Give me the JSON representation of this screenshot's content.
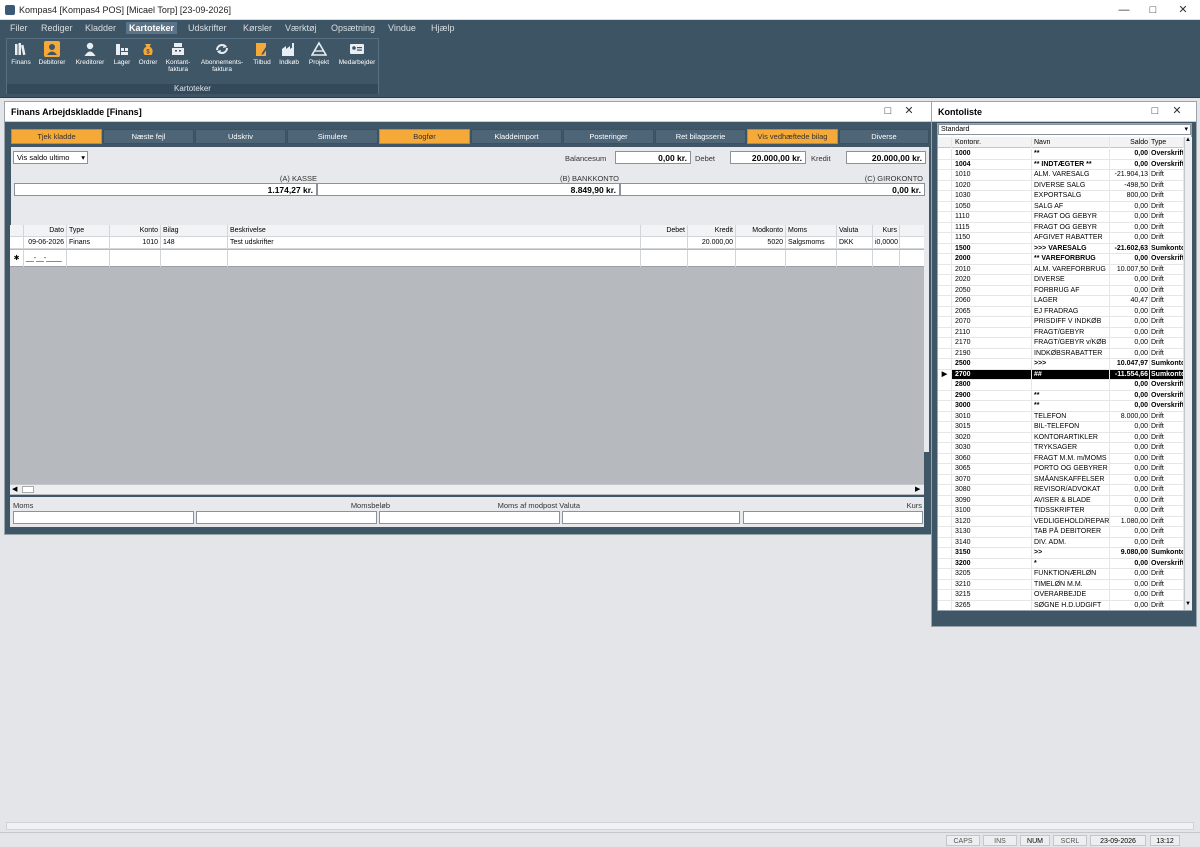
{
  "window": {
    "title": "Kompas4  [Kompas4 POS]  [Micael Torp]  [23-09-2026]"
  },
  "menu": [
    "Filer",
    "Rediger",
    "Kladder",
    "Kartoteker",
    "Udskrifter",
    "Kørsler",
    "Værktøj",
    "Opsætning",
    "Vindue",
    "Hjælp"
  ],
  "ribbon": {
    "group_label": "Kartoteker",
    "buttons": [
      {
        "label": "Finans",
        "icon": "books-icon"
      },
      {
        "label": "Debitorer",
        "icon": "debitor-icon"
      },
      {
        "label": "Kreditorer",
        "icon": "person-icon"
      },
      {
        "label": "Lager",
        "icon": "warehouse-icon"
      },
      {
        "label": "Ordrer",
        "icon": "money-bag-icon"
      },
      {
        "label": "Kontant-\nfaktura",
        "icon": "register-icon"
      },
      {
        "label": "Abonnements-\nfaktura",
        "icon": "repeat-icon"
      },
      {
        "label": "Tilbud",
        "icon": "document-edit-icon"
      },
      {
        "label": "Indkøb",
        "icon": "factory-icon"
      },
      {
        "label": "Projekt",
        "icon": "project-icon"
      },
      {
        "label": "Medarbejder",
        "icon": "id-card-icon"
      }
    ]
  },
  "finans": {
    "title": "Finans Arbejdskladde [Finans]",
    "toolbar": [
      "Tjek kladde",
      "Næste fejl",
      "Udskriv",
      "Simulere",
      "Bogfør",
      "Kladdeimport",
      "Posteringer",
      "Ret bilagsserie",
      "Vis vedhæftede bilag",
      "Diverse"
    ],
    "saldo_select": "Vis saldo ultimo",
    "balancesum_label": "Balancesum",
    "balancesum": "0,00 kr.",
    "debet_label": "Debet",
    "debet": "20.000,00 kr.",
    "kredit_label": "Kredit",
    "kredit": "20.000,00 kr.",
    "accounts": [
      {
        "label": "(A) KASSE",
        "value": "1.174,27 kr."
      },
      {
        "label": "(B) BANKKONTO",
        "value": "8.849,90 kr."
      },
      {
        "label": "(C) GIROKONTO",
        "value": "0,00 kr."
      }
    ],
    "columns": [
      "Dato",
      "Type",
      "Konto",
      "Bilag",
      "Beskrivelse",
      "Debet",
      "Kredit",
      "Modkonto",
      "Moms",
      "Valuta",
      "Kurs"
    ],
    "rows": [
      {
        "Dato": "09-06-2026",
        "Type": "Finans",
        "Konto": "1010",
        "Bilag": "148",
        "Beskrivelse": "Test udskrifter",
        "Debet": "",
        "Kredit": "20.000,00",
        "Modkonto": "5020",
        "Moms": "Salgsmoms",
        "Valuta": "DKK",
        "Kurs": "i0,0000"
      }
    ],
    "new_row_placeholder": "__-__-____",
    "footer": {
      "moms": "Moms",
      "momsbelob": "Momsbeløb",
      "moms_modpost": "Moms af modpost Valuta",
      "kurs": "Kurs"
    }
  },
  "kontoliste": {
    "title": "Kontoliste",
    "filter": "Standard",
    "columns": [
      "Kontonr.",
      "Navn",
      "Saldo",
      "Type"
    ],
    "rows": [
      {
        "nr": "1000",
        "navn": "**",
        "saldo": "0,00",
        "type": "Overskrift",
        "bold": true
      },
      {
        "nr": "1004",
        "navn": "** INDTÆGTER **",
        "saldo": "0,00",
        "type": "Overskrift",
        "bold": true
      },
      {
        "nr": "1010",
        "navn": "ALM. VARESALG",
        "saldo": "-21.904,13",
        "type": "Drift"
      },
      {
        "nr": "1020",
        "navn": "DIVERSE SALG",
        "saldo": "-498,50",
        "type": "Drift"
      },
      {
        "nr": "1030",
        "navn": "EXPORTSALG",
        "saldo": "800,00",
        "type": "Drift"
      },
      {
        "nr": "1050",
        "navn": "SALG AF",
        "saldo": "0,00",
        "type": "Drift"
      },
      {
        "nr": "1110",
        "navn": "FRAGT OG GEBYR",
        "saldo": "0,00",
        "type": "Drift"
      },
      {
        "nr": "1115",
        "navn": "FRAGT OG GEBYR",
        "saldo": "0,00",
        "type": "Drift"
      },
      {
        "nr": "1150",
        "navn": "AFGIVET RABATTER",
        "saldo": "0,00",
        "type": "Drift"
      },
      {
        "nr": "1500",
        "navn": ">>> VARESALG",
        "saldo": "-21.602,63",
        "type": "Sumkonto",
        "bold": true
      },
      {
        "nr": "2000",
        "navn": "** VAREFORBRUG",
        "saldo": "0,00",
        "type": "Overskrift",
        "bold": true
      },
      {
        "nr": "2010",
        "navn": "ALM. VAREFORBRUG",
        "saldo": "10.007,50",
        "type": "Drift"
      },
      {
        "nr": "2020",
        "navn": "DIVERSE",
        "saldo": "0,00",
        "type": "Drift"
      },
      {
        "nr": "2050",
        "navn": "FORBRUG AF",
        "saldo": "0,00",
        "type": "Drift"
      },
      {
        "nr": "2060",
        "navn": "LAGER",
        "saldo": "40,47",
        "type": "Drift"
      },
      {
        "nr": "2065",
        "navn": "EJ FRADRAG",
        "saldo": "0,00",
        "type": "Drift"
      },
      {
        "nr": "2070",
        "navn": "PRISDIFF V INDKØB",
        "saldo": "0,00",
        "type": "Drift"
      },
      {
        "nr": "2110",
        "navn": "FRAGT/GEBYR",
        "saldo": "0,00",
        "type": "Drift"
      },
      {
        "nr": "2170",
        "navn": "FRAGT/GEBYR v/KØB",
        "saldo": "0,00",
        "type": "Drift"
      },
      {
        "nr": "2190",
        "navn": "INDKØBSRABATTER",
        "saldo": "0,00",
        "type": "Drift"
      },
      {
        "nr": "2500",
        "navn": ">>>",
        "saldo": "10.047,97",
        "type": "Sumkonto",
        "bold": true
      },
      {
        "nr": "2700",
        "navn": "##",
        "saldo": "-11.554,66",
        "type": "Sumkonto",
        "bold": true,
        "selected": true
      },
      {
        "nr": "2800",
        "navn": "",
        "saldo": "0,00",
        "type": "Overskrift",
        "bold": true
      },
      {
        "nr": "2900",
        "navn": "**",
        "saldo": "0,00",
        "type": "Overskrift",
        "bold": true
      },
      {
        "nr": "3000",
        "navn": "**",
        "saldo": "0,00",
        "type": "Overskrift",
        "bold": true
      },
      {
        "nr": "3010",
        "navn": "TELEFON",
        "saldo": "8.000,00",
        "type": "Drift"
      },
      {
        "nr": "3015",
        "navn": "BIL-TELEFON",
        "saldo": "0,00",
        "type": "Drift"
      },
      {
        "nr": "3020",
        "navn": "KONTORARTIKLER",
        "saldo": "0,00",
        "type": "Drift"
      },
      {
        "nr": "3030",
        "navn": "TRYKSAGER",
        "saldo": "0,00",
        "type": "Drift"
      },
      {
        "nr": "3060",
        "navn": "FRAGT M.M. m/MOMS",
        "saldo": "0,00",
        "type": "Drift"
      },
      {
        "nr": "3065",
        "navn": "PORTO OG GEBYRER",
        "saldo": "0,00",
        "type": "Drift"
      },
      {
        "nr": "3070",
        "navn": "SMÅANSKAFFELSER",
        "saldo": "0,00",
        "type": "Drift"
      },
      {
        "nr": "3080",
        "navn": "REVISOR/ADVOKAT",
        "saldo": "0,00",
        "type": "Drift"
      },
      {
        "nr": "3090",
        "navn": "AVISER & BLADE",
        "saldo": "0,00",
        "type": "Drift"
      },
      {
        "nr": "3100",
        "navn": "TIDSSKRIFTER",
        "saldo": "0,00",
        "type": "Drift"
      },
      {
        "nr": "3120",
        "navn": "VEDLIGEHOLD/REPAR",
        "saldo": "1.080,00",
        "type": "Drift"
      },
      {
        "nr": "3130",
        "navn": "TAB PÅ DEBITORER",
        "saldo": "0,00",
        "type": "Drift"
      },
      {
        "nr": "3140",
        "navn": "DIV. ADM.",
        "saldo": "0,00",
        "type": "Drift"
      },
      {
        "nr": "3150",
        "navn": ">>",
        "saldo": "9.080,00",
        "type": "Sumkonto",
        "bold": true
      },
      {
        "nr": "3200",
        "navn": "*",
        "saldo": "0,00",
        "type": "Overskrift",
        "bold": true
      },
      {
        "nr": "3205",
        "navn": "FUNKTIONÆRLØN",
        "saldo": "0,00",
        "type": "Drift"
      },
      {
        "nr": "3210",
        "navn": "TIMELØN M.M.",
        "saldo": "0,00",
        "type": "Drift"
      },
      {
        "nr": "3215",
        "navn": "OVERARBEJDE",
        "saldo": "0,00",
        "type": "Drift"
      },
      {
        "nr": "3265",
        "navn": "SØGNE H.D.UDGIFT",
        "saldo": "0,00",
        "type": "Drift"
      }
    ]
  },
  "statusbar": {
    "caps": "CAPS",
    "ins": "INS",
    "num": "NUM",
    "scrl": "SCRL",
    "date": "23-09-2026",
    "time": "13:12"
  },
  "colors": {
    "frame": "#3d5465",
    "accent": "#f4a938"
  }
}
